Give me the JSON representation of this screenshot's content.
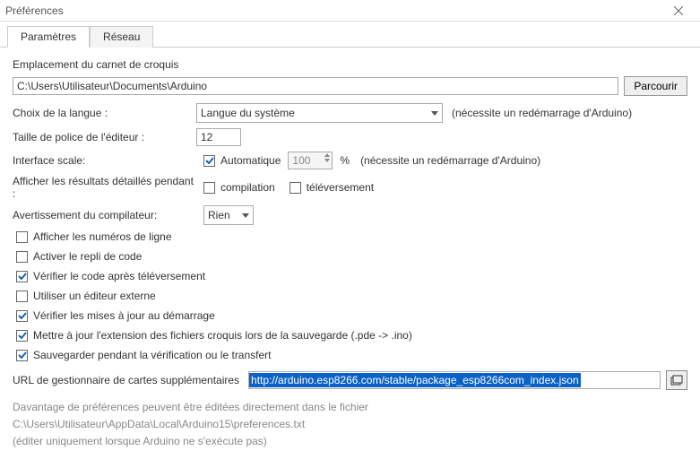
{
  "window": {
    "title": "Préférences"
  },
  "tabs": {
    "settings": "Paramètres",
    "network": "Réseau"
  },
  "sketch": {
    "heading": "Emplacement du carnet de croquis",
    "path": "C:\\Users\\Utilisateur\\Documents\\Arduino",
    "browse": "Parcourir"
  },
  "lang": {
    "label": "Choix de la langue :",
    "value": "Langue du système",
    "note": "(nécessite un redémarrage d'Arduino)"
  },
  "font": {
    "label": "Taille de police de l'éditeur :",
    "value": "12"
  },
  "scale": {
    "label": "Interface scale:",
    "auto": "Automatique",
    "value": "100",
    "pct": "%",
    "note": "(nécessite un redémarrage d'Arduino)"
  },
  "verbose": {
    "label": "Afficher les résultats détaillés pendant :",
    "compile": "compilation",
    "upload": "téléversement"
  },
  "warn": {
    "label": "Avertissement du compilateur:",
    "value": "Rien"
  },
  "opts": {
    "line_numbers": "Afficher les numéros de ligne",
    "code_folding": "Activer le repli de code",
    "verify_after": "Vérifier le code après téléversement",
    "external_editor": "Utiliser un éditeur externe",
    "check_updates": "Vérifier les mises à jour au démarrage",
    "update_ext": "Mettre à jour  l'extension des fichiers croquis lors de la sauvegarde (.pde -> .ino)",
    "save_verify": "Sauvegarder pendant la vérification ou le transfert"
  },
  "boards_url": {
    "label": "URL de gestionnaire de cartes supplémentaires",
    "value": "http://arduino.esp8266.com/stable/package_esp8266com_index.json"
  },
  "footer": {
    "line1": "Davantage de préférences peuvent être éditées directement dans le fichier",
    "line2": "C:\\Users\\Utilisateur\\AppData\\Local\\Arduino15\\preferences.txt",
    "line3": "(éditer uniquement lorsque Arduino ne s'exécute pas)"
  }
}
